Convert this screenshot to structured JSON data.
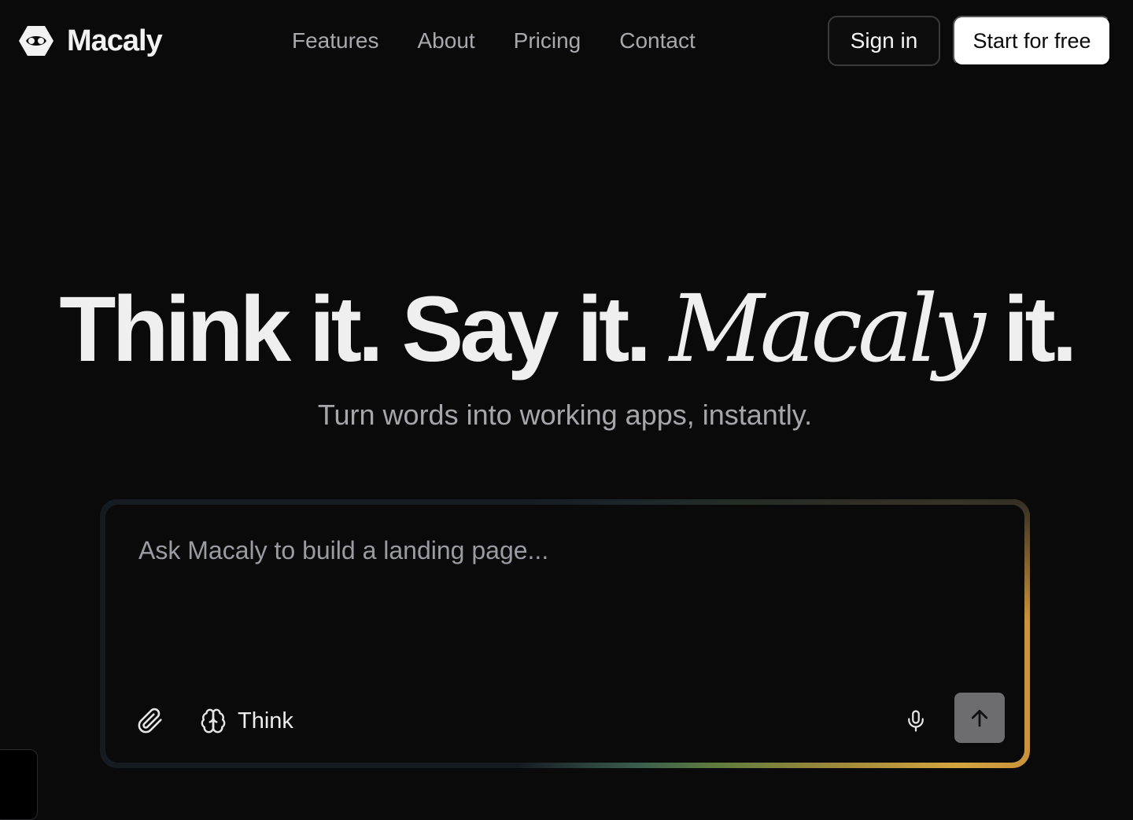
{
  "brand": {
    "name": "Macaly",
    "logo_icon": "macaly-logo-icon"
  },
  "nav": {
    "items": [
      {
        "label": "Features"
      },
      {
        "label": "About"
      },
      {
        "label": "Pricing"
      },
      {
        "label": "Contact"
      }
    ]
  },
  "header_actions": {
    "sign_in_label": "Sign in",
    "start_label": "Start for free"
  },
  "hero": {
    "title_part1": "Think it. Say it. ",
    "title_accent": "Macaly",
    "title_part2": " it.",
    "subtitle": "Turn words into working apps, instantly."
  },
  "prompt": {
    "placeholder": "Ask Macaly to build a landing page...",
    "value": "",
    "attach_icon": "paperclip-icon",
    "think_icon": "brain-icon",
    "think_label": "Think",
    "mic_icon": "microphone-icon",
    "send_icon": "arrow-up-icon"
  },
  "colors": {
    "background": "#0a0a0b",
    "accent_gradient": [
      "#3a5e4e",
      "#5d7b3e",
      "#a28a3a",
      "#d3a53f"
    ],
    "send_button": "#6d6d70"
  }
}
